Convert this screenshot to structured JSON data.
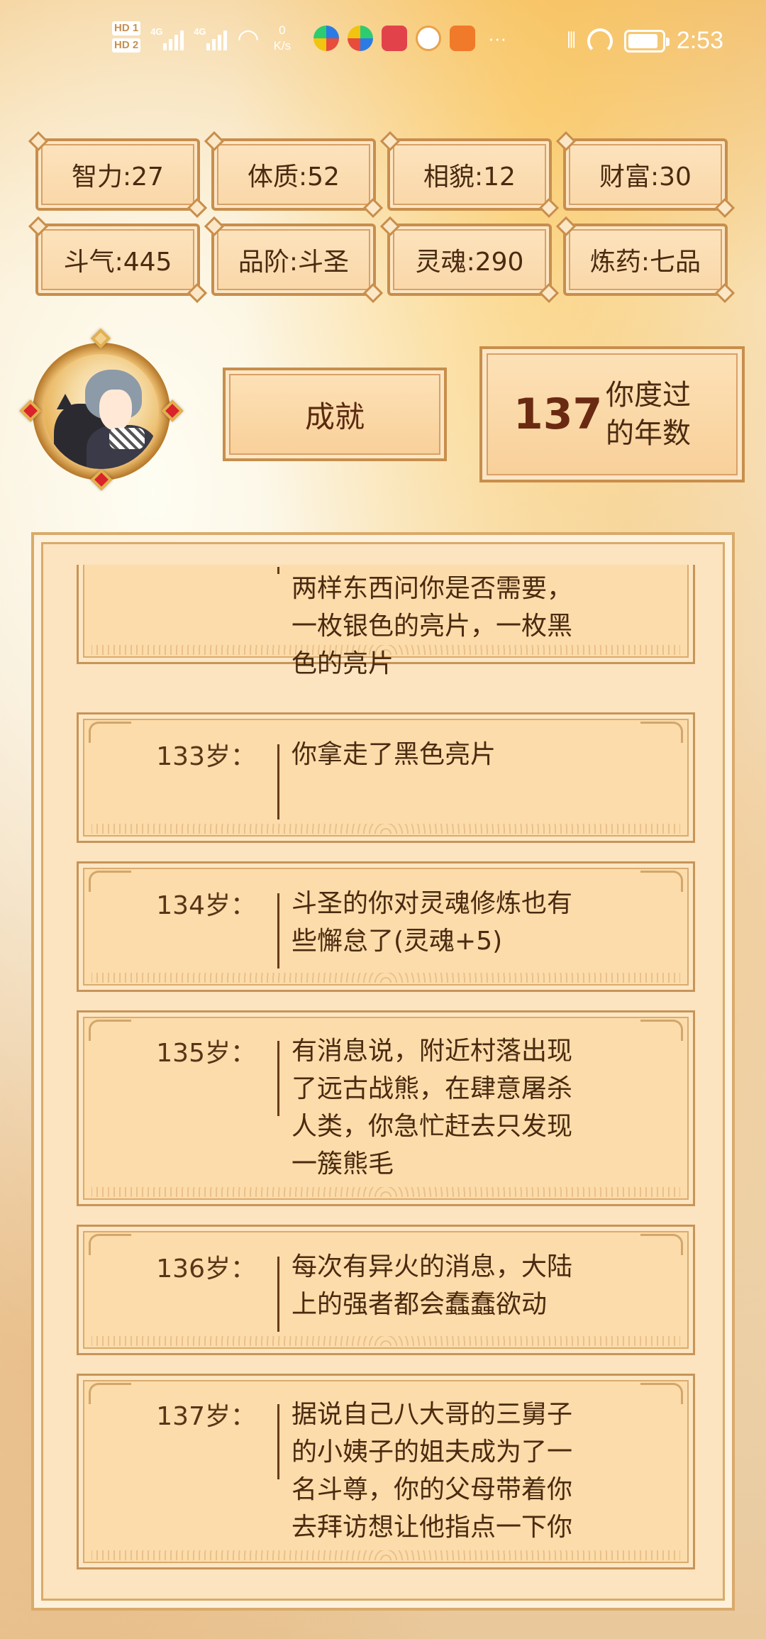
{
  "status_bar": {
    "time": "2:53",
    "hd1": "HD 1",
    "hd2": "HD 2",
    "net1": "4G",
    "net2": "4G",
    "speed_value": "0",
    "speed_unit": "K/s",
    "battery_level": 0.9,
    "app_icons": [
      "pinwheel-app-icon",
      "pinwheel-app-icon-2",
      "book-app-icon",
      "ball-app-icon",
      "play-app-icon"
    ]
  },
  "stats": [
    {
      "label": "智力:27"
    },
    {
      "label": "体质:52"
    },
    {
      "label": "相貌:12"
    },
    {
      "label": "财富:30"
    },
    {
      "label": "斗气:445"
    },
    {
      "label": "品阶:斗圣"
    },
    {
      "label": "灵魂:290"
    },
    {
      "label": "炼药:七品"
    }
  ],
  "achievement_button": "成就",
  "years": {
    "value": "137",
    "label_line1": "你度过",
    "label_line2": "的年数"
  },
  "history": [
    {
      "age": "",
      "lines": [
        "两样东西问你是否需要，",
        "一枚银色的亮片，一枚黑",
        "色的亮片"
      ]
    },
    {
      "age": "133岁：",
      "lines": [
        "你拿走了黑色亮片"
      ]
    },
    {
      "age": "134岁：",
      "lines": [
        "斗圣的你对灵魂修炼也有",
        "些懈怠了(灵魂+5)"
      ]
    },
    {
      "age": "135岁：",
      "lines": [
        "有消息说，附近村落出现",
        "了远古战熊，在肆意屠杀",
        "人类，你急忙赶去只发现",
        "一簇熊毛"
      ]
    },
    {
      "age": "136岁：",
      "lines": [
        "每次有异火的消息，大陆",
        "上的强者都会蠢蠢欲动"
      ]
    },
    {
      "age": "137岁：",
      "lines": [
        "据说自己八大哥的三舅子",
        "的小姨子的姐夫成为了一",
        "名斗尊，你的父母带着你",
        "去拜访想让他指点一下你"
      ]
    }
  ],
  "colors": {
    "border": "#c88e4c",
    "text": "#4a2a10",
    "card": "#fcdcaa"
  }
}
